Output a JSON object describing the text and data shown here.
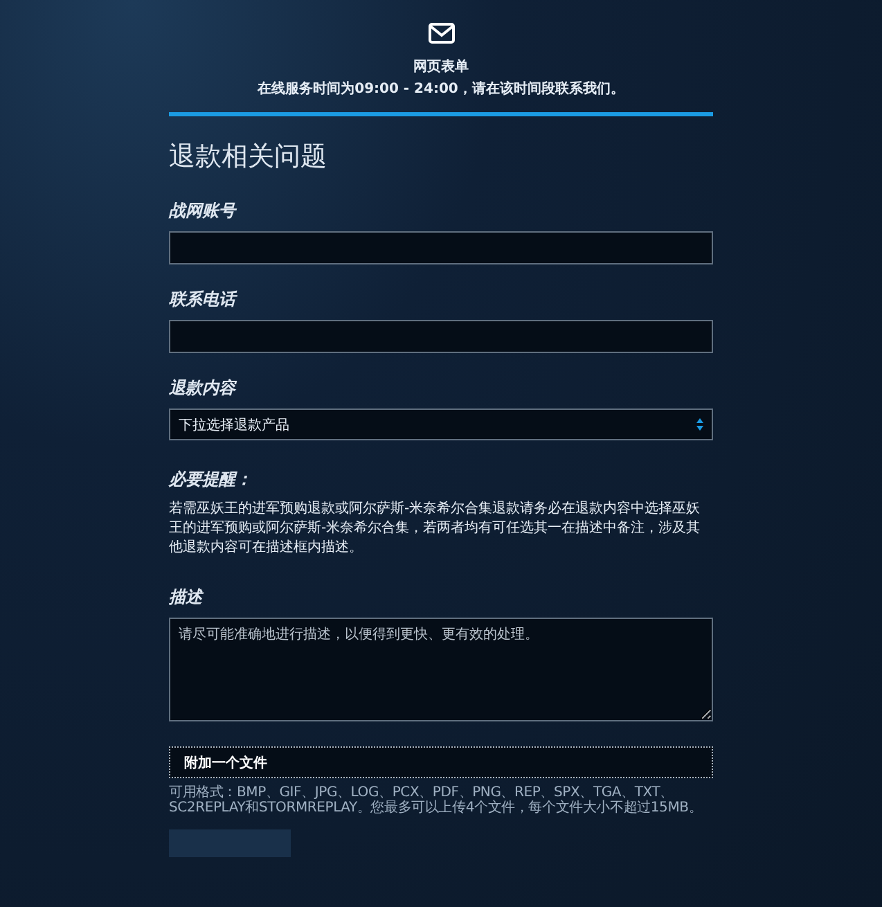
{
  "header": {
    "title": "网页表单",
    "hours": "在线服务时间为09:00 - 24:00，请在该时间段联系我们。"
  },
  "form": {
    "title": "退款相关问题",
    "fields": [
      {
        "kind": "text",
        "label": "战网账号"
      },
      {
        "kind": "text",
        "label": "联系电话"
      },
      {
        "kind": "select",
        "label": "退款内容",
        "value": "下拉选择退款产品"
      },
      {
        "kind": "notice",
        "label": "必要提醒：",
        "text": "若需巫妖王的进军预购退款或阿尔萨斯-米奈希尔合集退款请务必在退款内容中选择巫妖王的进军预购或阿尔萨斯-米奈希尔合集，若两者均有可任选其一在描述中备注，涉及其他退款内容可在描述框内描述。"
      },
      {
        "kind": "textarea",
        "label": "描述",
        "placeholder": "请尽可能准确地进行描述，以便得到更快、更有效的处理。"
      },
      {
        "kind": "file",
        "button": "附加一个文件",
        "hint": "可用格式：BMP、GIF、JPG、LOG、PCX、PDF、PNG、REP、SPX、TGA、TXT、SC2REPLAY和STORMREPLAY。您最多可以上传4个文件，每个文件大小不超过15MB。"
      }
    ]
  }
}
